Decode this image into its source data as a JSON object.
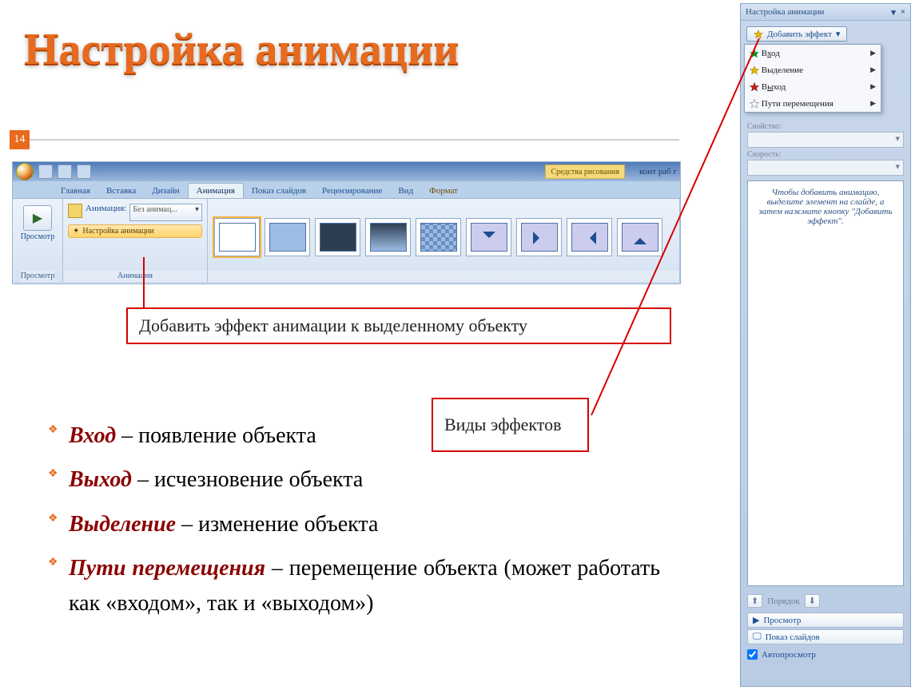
{
  "slide": {
    "title": "Настройка анимации",
    "number": "14"
  },
  "ribbon": {
    "context_tool": "Средства рисования",
    "doc_title": "конт раб г",
    "tabs": [
      "Главная",
      "Вставка",
      "Дизайн",
      "Анимация",
      "Показ слайдов",
      "Рецензирование",
      "Вид",
      "Формат"
    ],
    "active_tab": 3,
    "preview_label": "Просмотр",
    "preview_group": "Просмотр",
    "anim_label": "Анимация:",
    "anim_value": "Без анимац...",
    "anim_settings_btn": "Настройка анимации",
    "anim_group": "Анимация"
  },
  "annot": {
    "callout1": "Добавить эффект анимации к выделенному объекту",
    "callout2": "Виды эффектов"
  },
  "bullets": [
    {
      "term": "Вход",
      "desc": " – появление объекта",
      "justify": false
    },
    {
      "term": "Выход",
      "desc": " – исчезновение объекта",
      "justify": false
    },
    {
      "term": "Выделение",
      "desc": " – изменение объекта",
      "justify": false
    },
    {
      "term": "Пути перемещения",
      "desc": " – перемещение объекта (может работать как «входом», так и «выходом»)",
      "justify": true
    }
  ],
  "panel": {
    "title": "Настройка анимации",
    "add_btn": "Добавить эффект",
    "menu_items": [
      "Вход",
      "Выделение",
      "Выход",
      "Пути перемещения"
    ],
    "field1": "Свойство:",
    "field2": "Скорость:",
    "hint": "Чтобы добавить анимацию, выделите элемент на слайде, а затем нажмите кнопку \"Добавить эффект\".",
    "order": "Порядок",
    "preview_btn": "Просмотр",
    "slideshow_btn": "Показ слайдов",
    "autopreview": "Автопросмотр"
  },
  "star_colors": {
    "entry": "#1a8a1a",
    "emphasis": "#e8b400",
    "exit": "#c02020",
    "path": "#ffffff"
  }
}
